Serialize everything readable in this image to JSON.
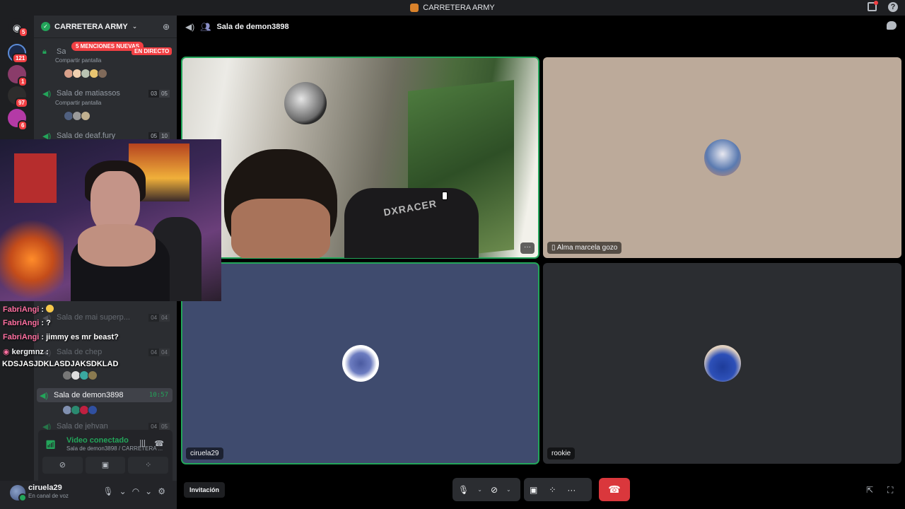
{
  "window": {
    "title": "CARRETERA ARMY"
  },
  "rail": {
    "servers": [
      {
        "badge": "5"
      },
      {
        "badge": "121"
      },
      {
        "badge": "1"
      },
      {
        "badge": "97"
      },
      {
        "badge": "6"
      }
    ]
  },
  "guild": {
    "name": "CARRETERA ARMY"
  },
  "channels": {
    "mentions_pill": "5 MENCIONES NUEVAS",
    "live_badge": "EN DIRECTO",
    "items": [
      {
        "name": "Sa",
        "sub": "Compartir pantalla"
      },
      {
        "name": "Sala de matiassos",
        "sub": "Compartir pantalla",
        "count_a": "03",
        "count_b": "05"
      },
      {
        "name": "Sala de deaf.fury",
        "count_a": "05",
        "count_b": "10"
      },
      {
        "name": "Sala de mai superp...",
        "count_a": "04",
        "count_b": "04"
      },
      {
        "name": "Sala de chep",
        "count_a": "04",
        "count_b": "04"
      },
      {
        "name": "Sala de demon3898",
        "timer": "10:57"
      },
      {
        "name": "Sala de jehvan",
        "count_a": "04",
        "count_b": "05"
      }
    ]
  },
  "voice_panel": {
    "status": "Video conectado",
    "channel": "Sala de demon3898 / CARRETERA ..."
  },
  "user": {
    "name": "ciruela29",
    "status": "En canal de voz"
  },
  "stream_chat": {
    "lines": [
      {
        "user": "FabriAngi",
        "text": ""
      },
      {
        "user": "FabriAngi",
        "text": "?"
      },
      {
        "user": "FabriAngi",
        "text": "jimmy es mr beast?"
      },
      {
        "user": "kergmnz",
        "text": ""
      }
    ],
    "long_line": "KDSJASJDKLASDJAKSDKLAD"
  },
  "call": {
    "header": "Sala de demon3898",
    "tiles": [
      {
        "label": ""
      },
      {
        "label": "Alma marcela gozo"
      },
      {
        "label": "ciruela29"
      },
      {
        "label": "rookie"
      }
    ],
    "camera_brand": "DXRACER",
    "invite_label": "Invitación"
  },
  "colors": {
    "accent_green": "#23a55a",
    "danger": "#da373c",
    "bg_dark": "#1e1f22",
    "sidebar": "#2b2d31"
  },
  "icons": [
    "discord-icon",
    "speaker-icon",
    "mic-icon",
    "camera-off-icon",
    "screen-share-icon",
    "activities-icon",
    "more-icon",
    "hangup-icon",
    "settings-icon",
    "headphones-icon",
    "popout-icon",
    "fullscreen-icon",
    "chat-icon",
    "help-icon",
    "inbox-icon"
  ]
}
